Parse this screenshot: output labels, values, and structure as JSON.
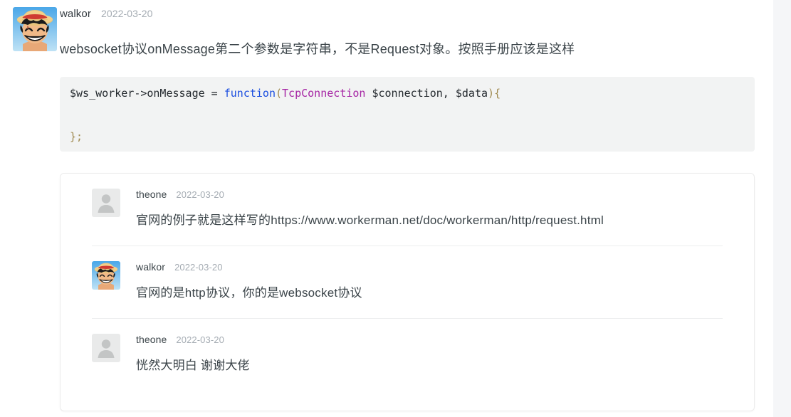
{
  "post": {
    "author": "walkor",
    "date": "2022-03-20",
    "avatar_icon": "luffy-avatar-icon",
    "body": "websocket协议onMessage第二个参数是字符串，不是Request对象。按照手册应该是这样",
    "code": {
      "language": "php",
      "line1": {
        "variable": "$ws_worker",
        "arrow": "->",
        "method": "onMessage",
        "space_eq": " = ",
        "keyword": "function",
        "open_paren": "(",
        "type": "TcpConnection",
        "args": " $connection, $data",
        "close": ")",
        "brace": "{"
      },
      "line_close": "};"
    }
  },
  "comments": [
    {
      "author": "theone",
      "date": "2022-03-20",
      "avatar_icon": "default-user-avatar-icon",
      "body": "官网的例子就是这样写的https://www.workerman.net/doc/workerman/http/request.html"
    },
    {
      "author": "walkor",
      "date": "2022-03-20",
      "avatar_icon": "luffy-avatar-icon",
      "body": "官网的是http协议，你的是websocket协议"
    },
    {
      "author": "theone",
      "date": "2022-03-20",
      "avatar_icon": "default-user-avatar-icon",
      "body": "恍然大明白 谢谢大佬"
    }
  ],
  "colors": {
    "page_background": "#ffffff",
    "gutter": "#f5f6f8",
    "code_background": "#f2f3f3",
    "card_border": "#ececec",
    "text_primary": "#3b4449",
    "text_muted": "#a5acb3",
    "code_keyword": "#1b4ee0",
    "code_type": "#a626a4",
    "code_punct": "#a08a50"
  }
}
